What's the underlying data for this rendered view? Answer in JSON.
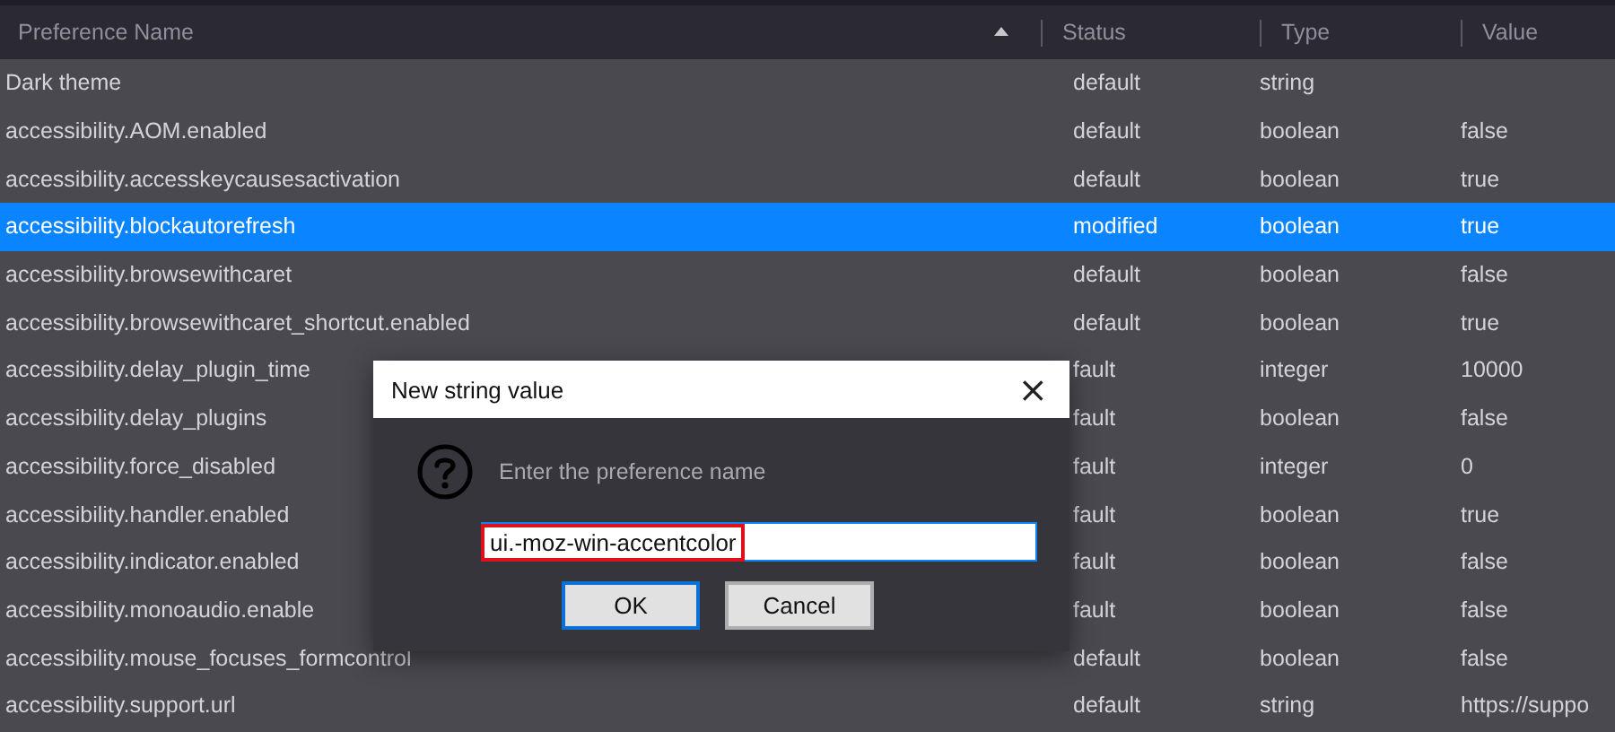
{
  "table": {
    "columns": [
      {
        "label": "Preference Name",
        "sorted": true
      },
      {
        "label": "Status",
        "sorted": false
      },
      {
        "label": "Type",
        "sorted": false
      },
      {
        "label": "Value",
        "sorted": false
      }
    ],
    "rows": [
      {
        "name": "Dark theme",
        "status": "default",
        "type": "string",
        "selected": false
      },
      {
        "name": "accessibility.AOM.enabled",
        "status": "default",
        "type": "boolean",
        "value": "false",
        "selected": false
      },
      {
        "name": "accessibility.accesskeycausesactivation",
        "status": "default",
        "type": "boolean",
        "value": "true",
        "selected": false
      },
      {
        "name": "accessibility.blockautorefresh",
        "status": "modified",
        "type": "boolean",
        "value": "true",
        "selected": true
      },
      {
        "name": "accessibility.browsewithcaret",
        "status": "default",
        "type": "boolean",
        "value": "false",
        "selected": false
      },
      {
        "name": "accessibility.browsewithcaret_shortcut.enabled",
        "status": "default",
        "type": "boolean",
        "value": "true",
        "selected": false
      },
      {
        "name": "accessibility.delay_plugin_time",
        "status": "fault",
        "type": "integer",
        "value": "10000",
        "selected": false
      },
      {
        "name": "accessibility.delay_plugins",
        "status": "fault",
        "type": "boolean",
        "value": "false",
        "selected": false
      },
      {
        "name": "accessibility.force_disabled",
        "status": "fault",
        "type": "integer",
        "value": "0",
        "selected": false
      },
      {
        "name": "accessibility.handler.enabled",
        "status": "fault",
        "type": "boolean",
        "value": "true",
        "selected": false
      },
      {
        "name": "accessibility.indicator.enabled",
        "status": "fault",
        "type": "boolean",
        "value": "false",
        "selected": false
      },
      {
        "name": "accessibility.monoaudio.enable",
        "status": "fault",
        "type": "boolean",
        "value": "false",
        "selected": false
      },
      {
        "name": "accessibility.mouse_focuses_formcontrol",
        "status": "default",
        "type": "boolean",
        "value": "false",
        "selected": false
      },
      {
        "name": "accessibility.support.url",
        "status": "default",
        "type": "string",
        "value": "https://suppo",
        "selected": false
      }
    ]
  },
  "dialog": {
    "title": "New string value",
    "close": "×",
    "prompt": "Enter the preference name",
    "value": "ui.-moz-win-accentcolor",
    "highlighted": true,
    "buttons": [
      {
        "label": "OK",
        "default": true
      },
      {
        "label": "Cancel",
        "default": false
      }
    ]
  }
}
